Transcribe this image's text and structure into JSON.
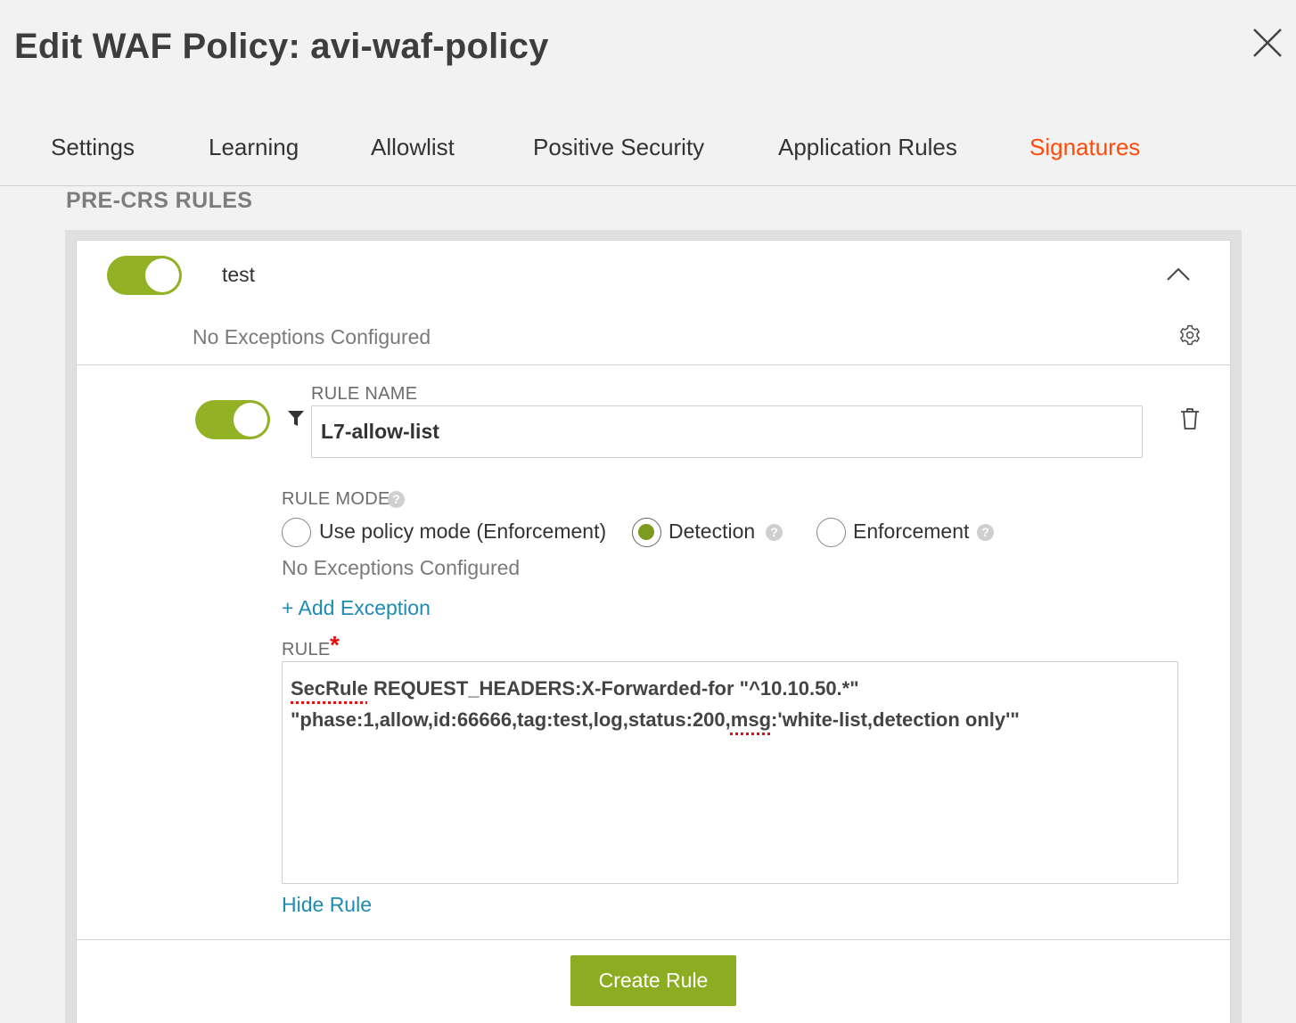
{
  "header": {
    "title": "Edit WAF Policy: avi-waf-policy",
    "close_icon": "close-icon"
  },
  "tabs": [
    {
      "label": "Settings",
      "active": false
    },
    {
      "label": "Learning",
      "active": false
    },
    {
      "label": "Allowlist",
      "active": false
    },
    {
      "label": "Positive Security",
      "active": false
    },
    {
      "label": "Application Rules",
      "active": false
    },
    {
      "label": "Signatures",
      "active": true
    }
  ],
  "colors": {
    "accent": "#ff4a0a",
    "toggle_on": "#92b125",
    "button": "#8cac22",
    "link": "#1e8bb0",
    "required": "#e01010"
  },
  "section": {
    "title": "PRE-CRS RULES"
  },
  "group": {
    "name": "test",
    "enabled": true,
    "exceptions_text": "No Exceptions Configured",
    "collapse_icon": "chevron-up-icon",
    "settings_icon": "gear-icon"
  },
  "rule": {
    "enabled": true,
    "filter_icon": "filter-icon",
    "delete_icon": "trash-icon",
    "name_label": "RULE NAME",
    "name_value": "L7-allow-list",
    "mode_label": "RULE MODE",
    "mode_options": [
      {
        "label": "Use policy mode (Enforcement)",
        "selected": false
      },
      {
        "label": "Detection",
        "selected": true
      },
      {
        "label": "Enforcement",
        "selected": false
      }
    ],
    "exceptions_text": "No Exceptions Configured",
    "add_exception": "+ Add Exception",
    "rule_label": "RULE",
    "required_mark": "*",
    "rule_text": {
      "line1_word1": "SecRule",
      "line1_rest": " REQUEST_HEADERS:X-Forwarded-for \"^10.10.50.*\"",
      "line2_start": "\"phase:1,allow,id:66666,tag:test,log,status:200,",
      "line2_word": "msg",
      "line2_end": ":'white-list,detection only'\""
    },
    "hide_rule": "Hide Rule"
  },
  "actions": {
    "create_label": "Create Rule"
  }
}
